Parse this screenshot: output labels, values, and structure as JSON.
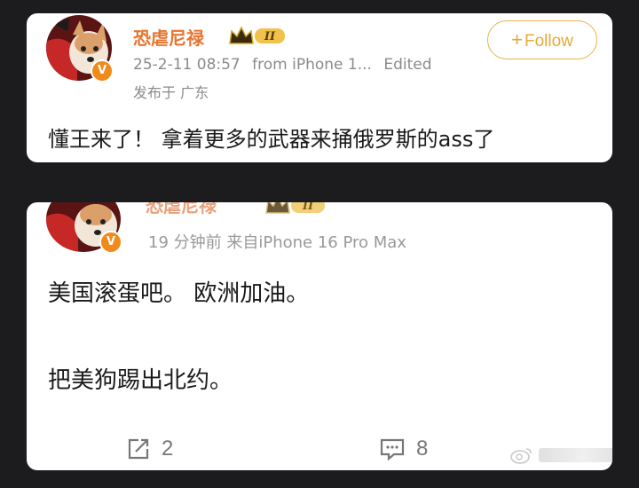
{
  "post1": {
    "username": "恐虐尼禄",
    "level_badge": "II",
    "verified_badge": "V",
    "timestamp": "25-2-11 08:57",
    "source": "from iPhone 1...",
    "edited": "Edited",
    "location": "发布于 广东",
    "follow_label": "Follow",
    "content": "懂王来了！  拿着更多的武器来捅俄罗斯的ass了"
  },
  "post2": {
    "username": "恐虐尼禄",
    "level_badge": "II",
    "verified_badge": "V",
    "meta": "19 分钟前  来自iPhone 16 Pro Max",
    "line1": "美国滚蛋吧。  欧洲加油。",
    "line2": "把美狗踢出北约。",
    "repost_count": "2",
    "comment_count": "8"
  },
  "icons": {
    "repost": "share-square-icon",
    "comment": "comment-bubble-icon",
    "crown": "crown-icon",
    "watermark": "weibo-logo-icon"
  },
  "colors": {
    "background": "#1c1c1f",
    "username": "#e8742e",
    "follow": "#e6a83a",
    "verified": "#f08a1a",
    "meta": "#8a8a8a"
  }
}
